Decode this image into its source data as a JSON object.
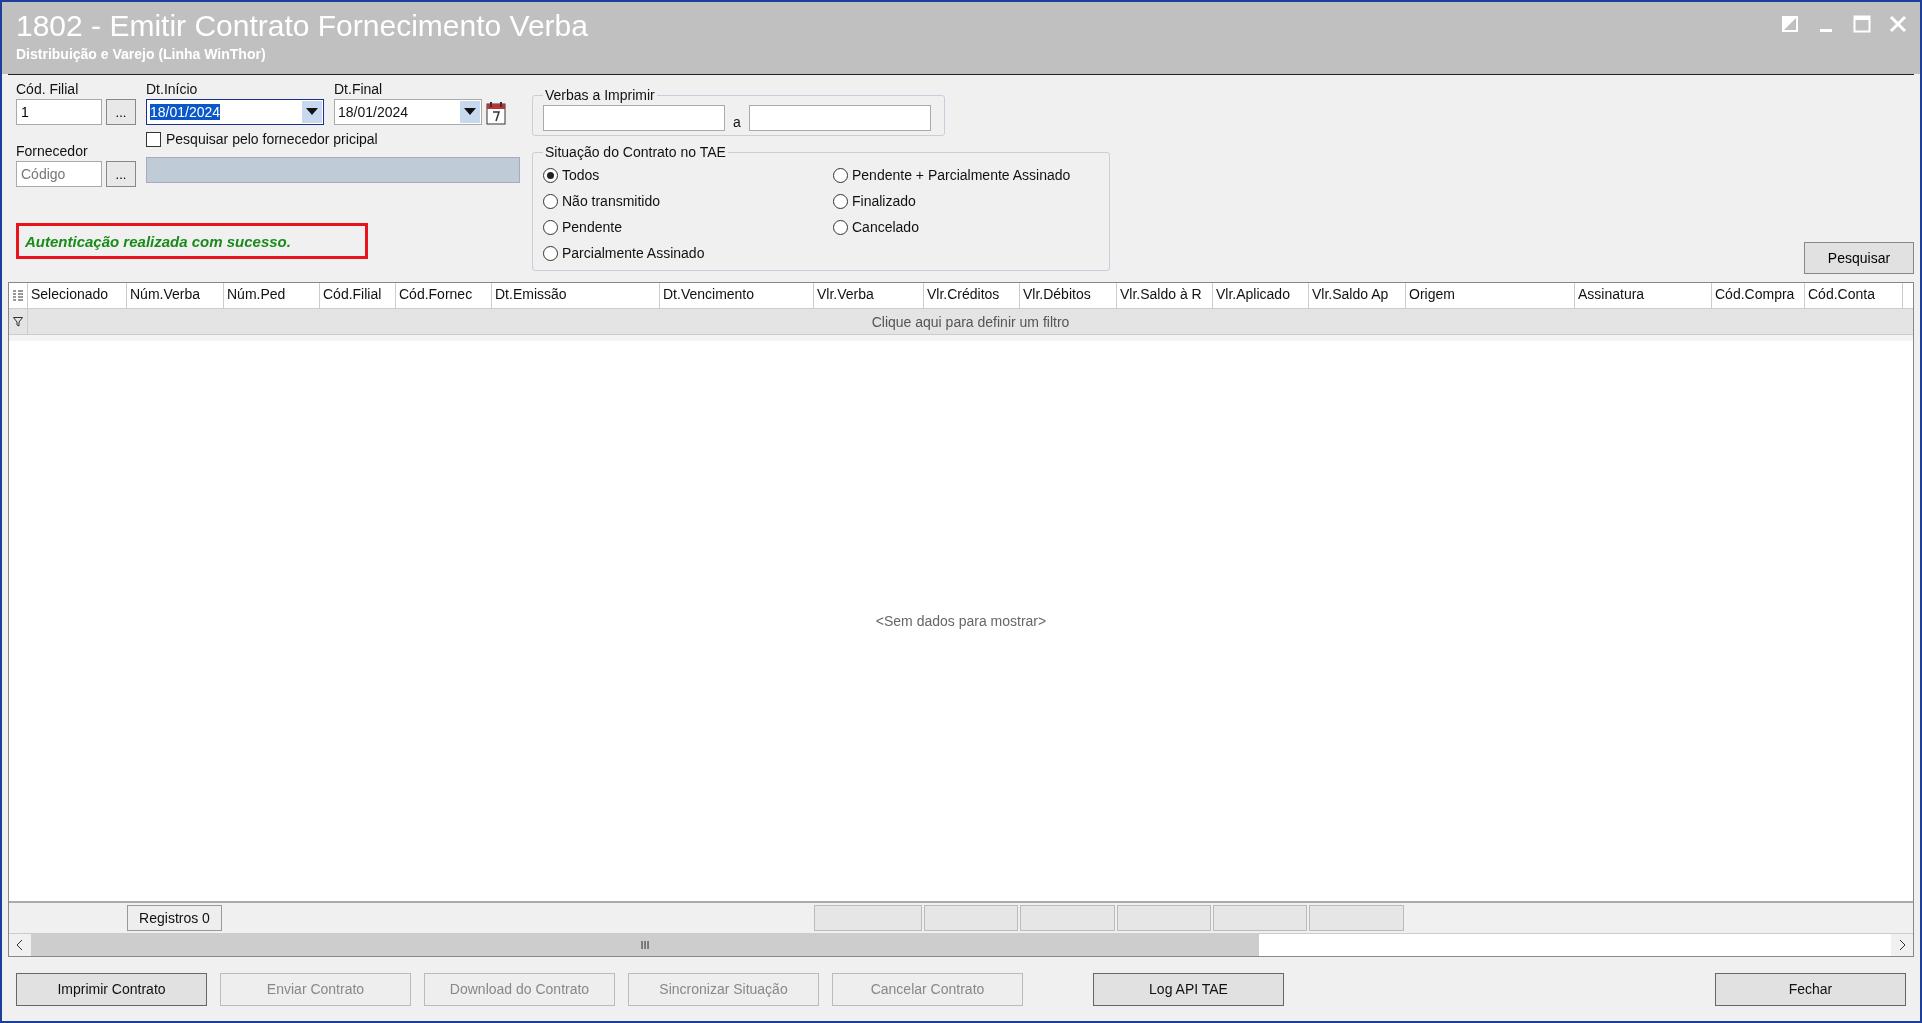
{
  "window": {
    "title": "1802 - Emitir Contrato Fornecimento Verba",
    "subtitle": "Distribuição e Varejo (Linha WinThor)"
  },
  "filters": {
    "filial": {
      "label": "Cód. Filial",
      "value": "1",
      "lookup": "..."
    },
    "start_date": {
      "label": "Dt.Início",
      "value": "18/01/2024",
      "focused": true
    },
    "end_date": {
      "label": "Dt.Final",
      "value": "18/01/2024",
      "focused": false
    },
    "supplier": {
      "label": "Fornecedor",
      "placeholder": "Código",
      "lookup": "..."
    },
    "main_supplier": {
      "label": "Pesquisar pelo fornecedor pricipal",
      "checked": false
    },
    "verbas": {
      "title": "Verbas a Imprimir",
      "separator": "a"
    },
    "status": {
      "title": "Situação do Contrato no TAE",
      "options": [
        {
          "label": "Todos",
          "selected": true
        },
        {
          "label": "Não transmitido",
          "selected": false
        },
        {
          "label": "Pendente",
          "selected": false
        },
        {
          "label": "Parcialmente Assinado",
          "selected": false
        },
        {
          "label": "Pendente + Parcialmente Assinado",
          "selected": false
        },
        {
          "label": "Finalizado",
          "selected": false
        },
        {
          "label": "Cancelado",
          "selected": false
        }
      ]
    },
    "message": "Autenticação realizada com sucesso.",
    "search_button": "Pesquisar"
  },
  "table": {
    "columns": [
      {
        "label": "Selecionado",
        "summary": false
      },
      {
        "label": "Núm.Verba",
        "summary": false
      },
      {
        "label": "Núm.Ped",
        "summary": false
      },
      {
        "label": "Cód.Filial",
        "summary": false
      },
      {
        "label": "Cód.Fornec",
        "summary": false
      },
      {
        "label": "Dt.Emissão",
        "summary": false
      },
      {
        "label": "Dt.Vencimento",
        "summary": false
      },
      {
        "label": "Vlr.Verba",
        "summary": true
      },
      {
        "label": "Vlr.Créditos",
        "summary": true
      },
      {
        "label": "Vlr.Débitos",
        "summary": true
      },
      {
        "label": "Vlr.Saldo à R",
        "summary": true
      },
      {
        "label": "Vlr.Aplicado",
        "summary": true
      },
      {
        "label": "Vlr.Saldo Ap",
        "summary": true
      },
      {
        "label": "Origem",
        "summary": false
      },
      {
        "label": "Assinatura",
        "summary": false
      },
      {
        "label": "Cód.Compra",
        "summary": false
      },
      {
        "label": "Cód.Conta",
        "summary": false
      }
    ],
    "filter_hint": "Clique aqui para definir um filtro",
    "empty": "<Sem dados para mostrar>",
    "count": "Registros 0",
    "scroll_thumb": "III"
  },
  "buttons": [
    {
      "label": "Imprimir Contrato",
      "enabled": true
    },
    {
      "label": "Enviar Contrato",
      "enabled": false
    },
    {
      "label": "Download do Contrato",
      "enabled": false
    },
    {
      "label": "Sincronizar Situação",
      "enabled": false
    },
    {
      "label": "Cancelar Contrato",
      "enabled": false
    },
    {
      "label": "Log API TAE",
      "enabled": true
    }
  ],
  "close_button": "Fechar"
}
